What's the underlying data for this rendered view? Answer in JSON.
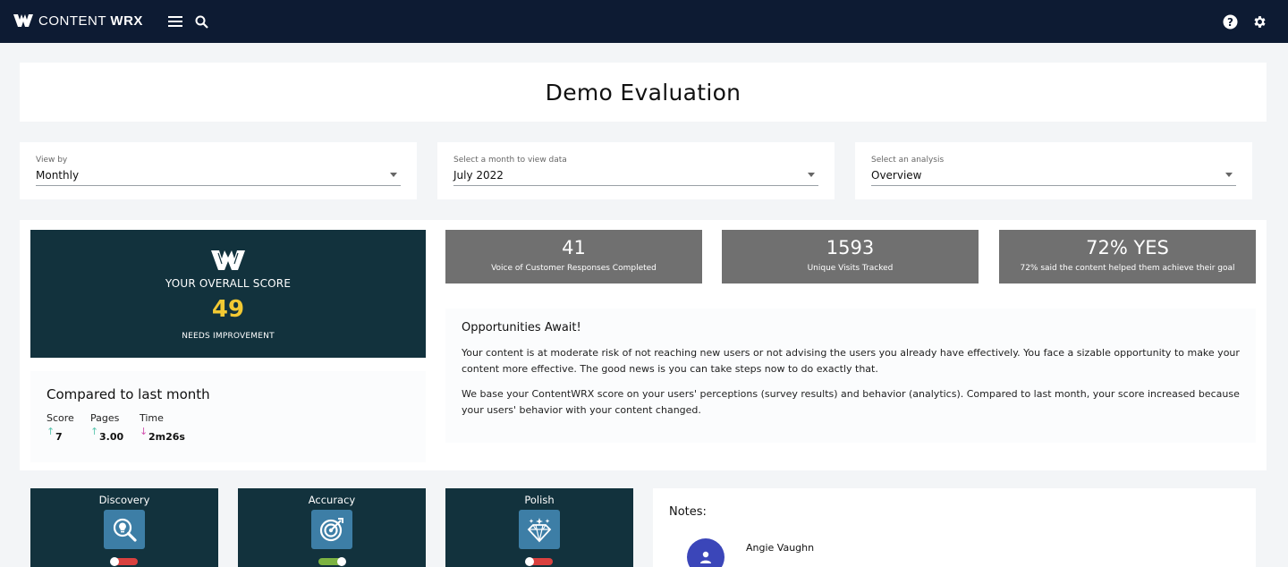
{
  "brand": {
    "name_light": "CONTENT",
    "name_bold": "WRX"
  },
  "topbar": {
    "menu_icon": "hamburger-menu-icon",
    "search_icon": "search-icon",
    "help_icon": "help-icon",
    "settings_icon": "gear-icon"
  },
  "page": {
    "title": "Demo Evaluation"
  },
  "filters": {
    "view_by": {
      "label": "View by",
      "value": "Monthly"
    },
    "month": {
      "label": "Select a month to view data",
      "value": "July 2022"
    },
    "analysis": {
      "label": "Select an analysis",
      "value": "Overview"
    }
  },
  "score": {
    "title": "YOUR OVERALL SCORE",
    "value": "49",
    "status": "NEEDS IMPROVEMENT"
  },
  "compare": {
    "title": "Compared to last month",
    "metrics": [
      {
        "label": "Score",
        "value": "7",
        "trend": "up"
      },
      {
        "label": "Pages",
        "value": "3.00",
        "trend": "up"
      },
      {
        "label": "Time",
        "value": "2m26s",
        "trend": "down"
      }
    ]
  },
  "stats": [
    {
      "value": "41",
      "label": "Voice of Customer Responses Completed"
    },
    {
      "value": "1593",
      "label": "Unique Visits Tracked"
    },
    {
      "value": "72% YES",
      "label": "72% said the content helped them achieve their goal"
    }
  ],
  "opportunity": {
    "title": "Opportunities Await!",
    "p1": "Your content is at moderate risk of not reaching new users or not advising the users you already have effectively. You face a sizable opportunity to make your content more effective. The good news is you can take steps now to do exactly that.",
    "p2": "We base your ContentWRX score on your users' perceptions (survey results) and behavior (analytics). Compared to last month, your score increased because your users' behavior with your content changed."
  },
  "categories": [
    {
      "name": "Discovery",
      "icon": "lightbulb-magnifier-icon",
      "status": "off"
    },
    {
      "name": "Accuracy",
      "icon": "target-icon",
      "status": "on"
    },
    {
      "name": "Polish",
      "icon": "diamond-icon",
      "status": "off"
    }
  ],
  "notes": {
    "title": "Notes:",
    "author": "Angie Vaughn",
    "avatar_icon": "person-icon"
  },
  "colors": {
    "topbar": "#0d1b33",
    "dark_teal": "#12323d",
    "score_yellow": "#f2c933",
    "stat_gray": "#707070",
    "up": "#5cc6b0",
    "down": "#d455b1",
    "toggle_on": "#7cb342",
    "toggle_off": "#d9413f",
    "icon_blue": "#3d7ea6",
    "avatar": "#3b46b9"
  }
}
